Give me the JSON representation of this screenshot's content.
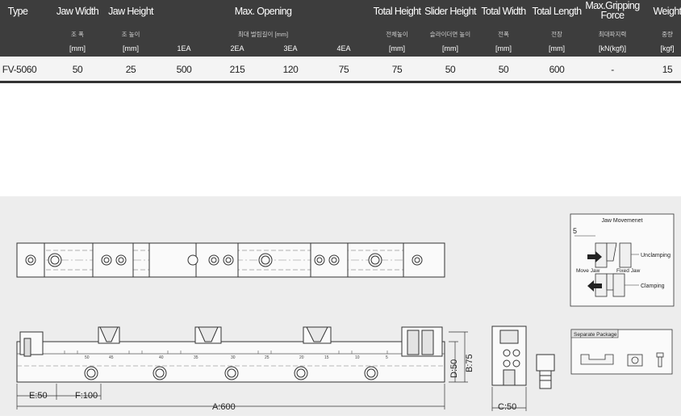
{
  "spec_table": {
    "headers": {
      "type": "Type",
      "jaw_width": "Jaw Width",
      "jaw_height": "Jaw Height",
      "max_opening": "Max. Opening",
      "total_height": "Total Height",
      "slider_height": "Slider Height",
      "total_width": "Total Width",
      "total_length": "Total Length",
      "max_gripping_force_line1": "Max.Gripping",
      "max_gripping_force_line2": "Force",
      "weight": "Weight"
    },
    "korean_labels": {
      "jaw_width": "조 폭",
      "jaw_height": "조 높이",
      "max_opening": "최대 벌림길이 [mm]",
      "total_height": "전체높이",
      "slider_height": "슬라이더면 높이",
      "total_width": "전폭",
      "total_length": "전장",
      "max_gripping_force": "최대파지력",
      "weight": "중량"
    },
    "units": {
      "jaw_width": "[mm]",
      "jaw_height": "[mm]",
      "opening_1ea": "1EA",
      "opening_2ea": "2EA",
      "opening_3ea": "3EA",
      "opening_4ea": "4EA",
      "total_height": "[mm]",
      "slider_height": "[mm]",
      "total_width": "[mm]",
      "total_length": "[mm]",
      "max_gripping_force": "[kN(kgf)]",
      "weight": "[kgf]"
    },
    "row": {
      "type": "FV-5060",
      "jaw_width": "50",
      "jaw_height": "25",
      "opening_1ea": "500",
      "opening_2ea": "215",
      "opening_3ea": "120",
      "opening_4ea": "75",
      "total_height": "75",
      "slider_height": "50",
      "total_width": "50",
      "total_length": "600",
      "max_gripping_force": "-",
      "weight": "15"
    }
  },
  "drawing": {
    "dimensions": {
      "e": "E:50",
      "f": "F:100",
      "a": "A:600",
      "d": "D:50",
      "b": "B:75",
      "c": "C:50"
    },
    "scale_marks": [
      "50",
      "45",
      "40",
      "35",
      "30",
      "25",
      "20",
      "15",
      "10",
      "5"
    ],
    "jaw_movement": {
      "title": "Jaw Movemenet",
      "offset": "5",
      "unclamping": "Unclamping",
      "move_jaw": "Move Jaw",
      "fixed_jaw": "Fixed Jaw",
      "clamping": "Clamping"
    },
    "separate_package": {
      "title": "Separate Package"
    }
  }
}
